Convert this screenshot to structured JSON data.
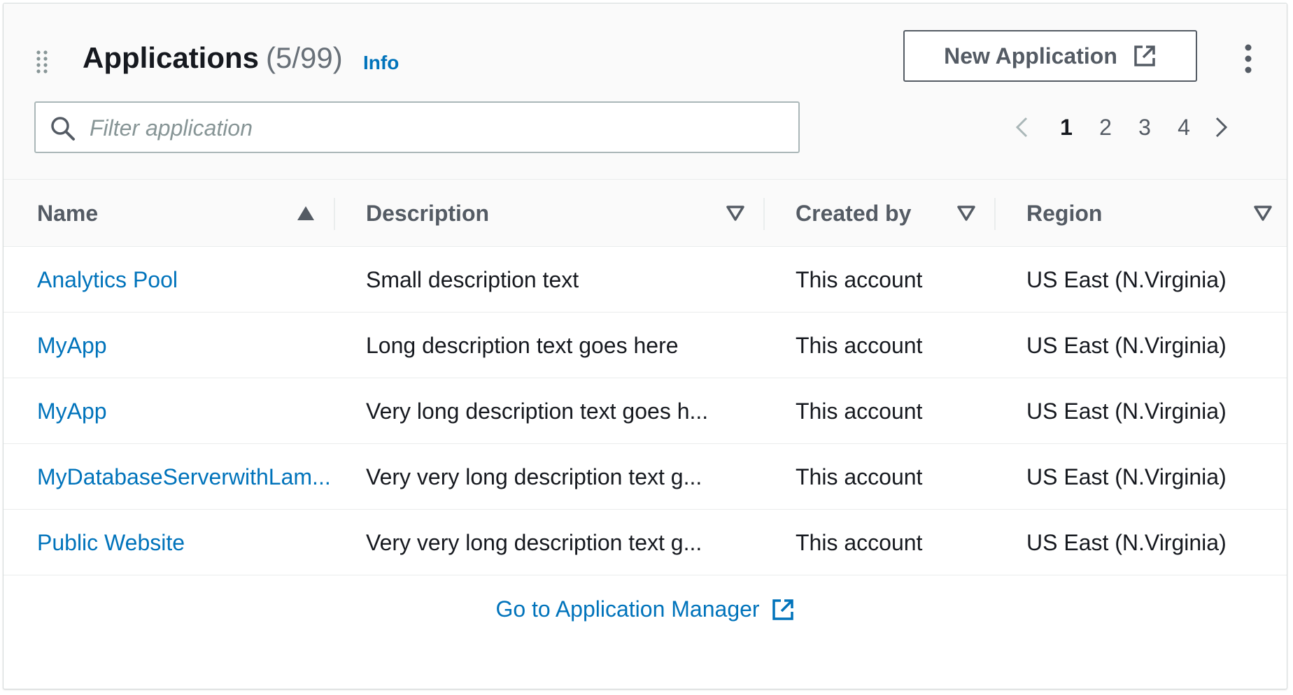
{
  "header": {
    "title": "Applications",
    "count": "(5/99)",
    "info_label": "Info",
    "new_app_label": "New Application"
  },
  "filter": {
    "placeholder": "Filter application",
    "value": ""
  },
  "pagination": {
    "pages": [
      "1",
      "2",
      "3",
      "4"
    ],
    "current": "1"
  },
  "table": {
    "columns": [
      "Name",
      "Description",
      "Created by",
      "Region"
    ],
    "sort": {
      "column": "Name",
      "direction": "ascending"
    },
    "rows": [
      {
        "name": "Analytics Pool",
        "description": "Small description text",
        "created_by": "This account",
        "region": "US East (N.Virginia)"
      },
      {
        "name": "MyApp",
        "description": "Long description text goes here",
        "created_by": "This account",
        "region": "US East (N.Virginia)"
      },
      {
        "name": "MyApp",
        "description": "Very long description text goes h...",
        "created_by": "This account",
        "region": "US East (N.Virginia)"
      },
      {
        "name": "MyDatabaseServerwithLam...",
        "description": "Very very long description text g...",
        "created_by": "This account",
        "region": "US East (N.Virginia)"
      },
      {
        "name": "Public Website",
        "description": "Very very long description text g...",
        "created_by": "This account",
        "region": "US East (N.Virginia)"
      }
    ]
  },
  "footer": {
    "link_label": "Go to Application Manager"
  },
  "icons": {
    "drag": "drag-handle-icon",
    "external": "external-link-icon",
    "more": "more-vertical-icon",
    "search": "search-icon",
    "prev": "chevron-left-icon",
    "next": "chevron-right-icon",
    "sort_asc": "sort-ascending-icon",
    "sort_desc": "sort-descending-icon"
  },
  "colors": {
    "link": "#0073bb",
    "text": "#16191f",
    "muted": "#545b64",
    "border": "#eaeded",
    "header_bg": "#fafafa"
  }
}
